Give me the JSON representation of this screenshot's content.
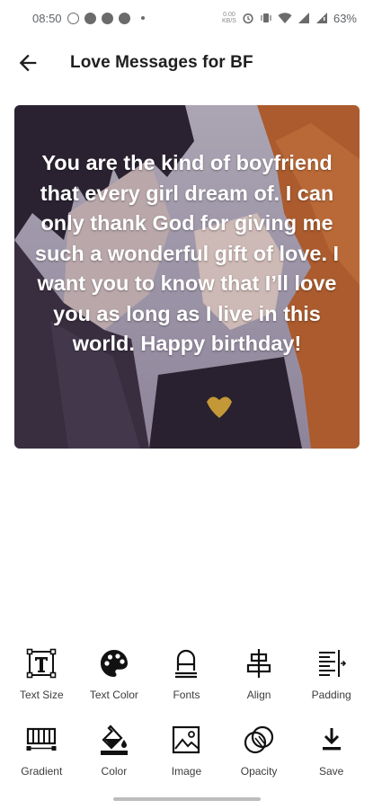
{
  "status_bar": {
    "time": "08:50",
    "net_speed_top": "0.00",
    "net_speed_bottom": "KB/S",
    "battery": "63%"
  },
  "app_bar": {
    "title": "Love Messages for BF",
    "back_icon": "arrow-left-icon"
  },
  "card": {
    "message": "You are the kind of boyfriend that every girl dream of. I can only thank God for giving me such a wonderful gift of love. I want you to know that I’ll love you as long as I live in this world. Happy birthday!",
    "text_color": "#ffffff"
  },
  "toolbar": {
    "row1": [
      {
        "label": "Text Size",
        "icon": "text-size-icon"
      },
      {
        "label": "Text Color",
        "icon": "palette-icon"
      },
      {
        "label": "Fonts",
        "icon": "font-icon"
      },
      {
        "label": "Align",
        "icon": "align-center-icon"
      },
      {
        "label": "Padding",
        "icon": "padding-icon"
      }
    ],
    "row2": [
      {
        "label": "Gradient",
        "icon": "gradient-icon"
      },
      {
        "label": "Color",
        "icon": "paint-bucket-icon"
      },
      {
        "label": "Image",
        "icon": "image-icon"
      },
      {
        "label": "Opacity",
        "icon": "opacity-icon"
      },
      {
        "label": "Save",
        "icon": "download-icon"
      }
    ]
  },
  "colors": {
    "icon": "#111111",
    "label": "#3c3c3c",
    "title": "#1f1f1f"
  }
}
